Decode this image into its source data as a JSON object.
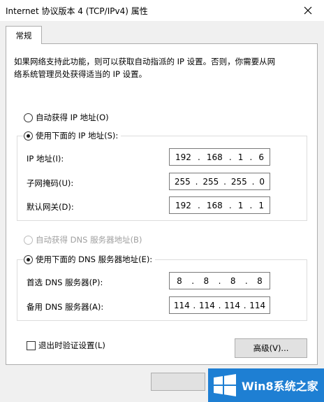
{
  "window": {
    "title": "Internet 协议版本 4 (TCP/IPv4) 属性"
  },
  "tabs": [
    {
      "label": "常规"
    }
  ],
  "description": [
    "如果网络支持此功能，则可以获取自动指派的 IP 设置。否则，你需要从网",
    "络系统管理员处获得适当的 IP 设置。"
  ],
  "ip_mode": {
    "auto_label": "自动获得 IP 地址(O)",
    "manual_label": "使用下面的 IP 地址(S):",
    "selected": "manual"
  },
  "ip_fields": [
    {
      "label": "IP 地址(I):",
      "octets": [
        "192",
        "168",
        "1",
        "6"
      ]
    },
    {
      "label": "子网掩码(U):",
      "octets": [
        "255",
        "255",
        "255",
        "0"
      ]
    },
    {
      "label": "默认网关(D):",
      "octets": [
        "192",
        "168",
        "1",
        "1"
      ]
    }
  ],
  "dns_mode": {
    "auto_label": "自动获得 DNS 服务器地址(B)",
    "manual_label": "使用下面的 DNS 服务器地址(E):",
    "selected": "manual"
  },
  "dns_fields": [
    {
      "label": "首选 DNS 服务器(P):",
      "octets": [
        "8",
        "8",
        "8",
        "8"
      ]
    },
    {
      "label": "备用 DNS 服务器(A):",
      "octets": [
        "114",
        "114",
        "114",
        "114"
      ]
    }
  ],
  "validate_checkbox": {
    "label": "退出时验证设置(L)",
    "checked": false
  },
  "advanced_button": "高级(V)...",
  "watermark": {
    "text": "Win8系统之家"
  },
  "colors": {
    "watermark_bg": "#1e7fd3",
    "disabled_text": "#a0a0a0"
  },
  "icons": {
    "close": "close-icon",
    "logo": "windows-logo-icon"
  }
}
